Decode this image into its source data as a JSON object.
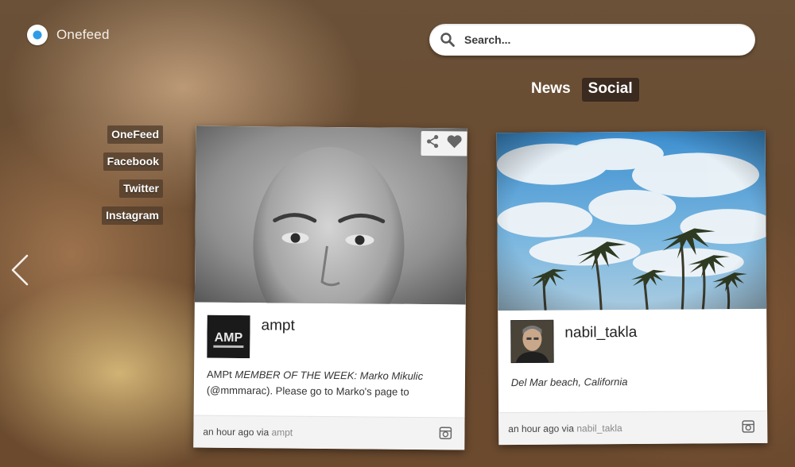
{
  "app": {
    "name": "Onefeed"
  },
  "search": {
    "placeholder": "Search..."
  },
  "tabs": [
    {
      "label": "News",
      "active": false
    },
    {
      "label": "Social",
      "active": true
    }
  ],
  "sources": [
    {
      "label": "OneFeed"
    },
    {
      "label": "Facebook"
    },
    {
      "label": "Twitter"
    },
    {
      "label": "Instagram"
    }
  ],
  "icons": {
    "logo": "onefeed-logo-icon",
    "search": "search-icon",
    "previous": "chevron-left-icon",
    "share": "share-icon",
    "like": "heart-icon",
    "instagram": "instagram-icon"
  },
  "posts": [
    {
      "username": "ampt",
      "avatar_text": "AMP",
      "caption_line1_plain": "AMPt ",
      "caption_line1_italic": "MEMBER OF THE WEEK: Marko Mikulic",
      "caption_line2": "(@mmmarac). Please go to Marko's page to",
      "time": "an hour ago",
      "via_label": "via",
      "via_source": "ampt"
    },
    {
      "username": "nabil_takla",
      "caption": "Del Mar beach, California",
      "time": "an hour ago",
      "via_label": "via",
      "via_source": "nabil_takla"
    }
  ],
  "colors": {
    "accent_dark": "#3a2a1f",
    "logo_blue": "#2e9be6",
    "card_bg": "#ffffff",
    "footer_bg": "#f3f3f3"
  }
}
